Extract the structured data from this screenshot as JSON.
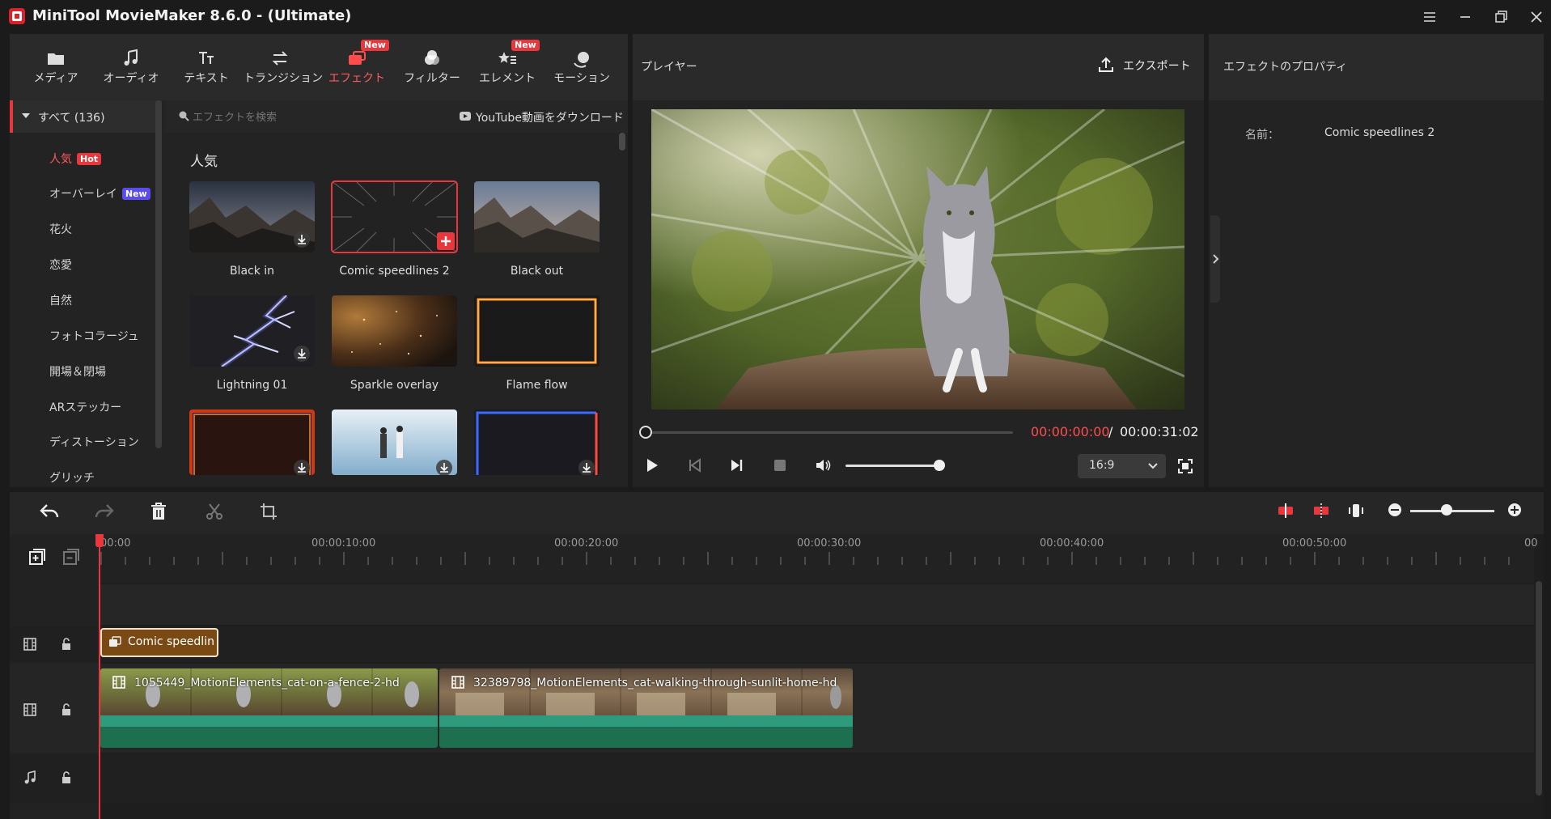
{
  "window": {
    "title": "MiniTool MovieMaker 8.6.0 - (Ultimate)",
    "icons": [
      "menu-icon",
      "minimize-icon",
      "maximize-icon",
      "close-icon"
    ]
  },
  "toolbar": {
    "items": [
      {
        "label": "メディア",
        "icon": "folder-icon"
      },
      {
        "label": "オーディオ",
        "icon": "music-icon"
      },
      {
        "label": "テキスト",
        "icon": "text-icon"
      },
      {
        "label": "トランジション",
        "icon": "transition-icon"
      },
      {
        "label": "エフェクト",
        "icon": "effects-icon",
        "badge": "New",
        "active": true
      },
      {
        "label": "フィルター",
        "icon": "filter-icon"
      },
      {
        "label": "エレメント",
        "icon": "elements-icon",
        "badge": "New"
      },
      {
        "label": "モーション",
        "icon": "motion-icon"
      }
    ]
  },
  "categories": {
    "all": "すべて (136)",
    "items": [
      {
        "label": "人気",
        "badge": "Hot",
        "active": true
      },
      {
        "label": "オーバーレイ",
        "badge": "New"
      },
      {
        "label": "花火"
      },
      {
        "label": "恋愛"
      },
      {
        "label": "自然"
      },
      {
        "label": "フォトコラージュ"
      },
      {
        "label": "開場＆閉場"
      },
      {
        "label": "ARステッカー"
      },
      {
        "label": "ディストーション"
      },
      {
        "label": "グリッチ"
      }
    ]
  },
  "effects": {
    "search_placeholder": "エフェクトを検索",
    "youtube_label": "YouTube動画をダウンロード",
    "section_title": "人気",
    "items": [
      {
        "label": "Black in"
      },
      {
        "label": "Comic speedlines 2"
      },
      {
        "label": "Black out"
      },
      {
        "label": "Lightning 01"
      },
      {
        "label": "Sparkle overlay"
      },
      {
        "label": "Flame flow"
      }
    ]
  },
  "player": {
    "title": "プレイヤー",
    "export_label": "エクスポート",
    "time_current": "00:00:00:00",
    "time_separator": "/",
    "time_total": "00:00:31:02",
    "aspect_ratio": "16:9",
    "progress": 0
  },
  "properties": {
    "title": "エフェクトのプロパティ",
    "name_label": "名前：",
    "name_value": "Comic speedlines 2"
  },
  "timeline": {
    "ruler_labels": [
      "00:00",
      "00:00:10:00",
      "00:00:20:00",
      "00:00:30:00",
      "00:00:40:00",
      "00:00:50:00",
      "00"
    ],
    "effect_clip": "Comic speedlin",
    "clips": [
      {
        "name": "1055449_MotionElements_cat-on-a-fence-2-hd"
      },
      {
        "name": "32389798_MotionElements_cat-walking-through-sunlit-home-hd"
      }
    ]
  },
  "colors": {
    "accent": "#e8383d",
    "clip_green": "#2e9c7c",
    "effect_clip": "#7a4a14",
    "new_badge_purple": "#5b4cf0"
  }
}
